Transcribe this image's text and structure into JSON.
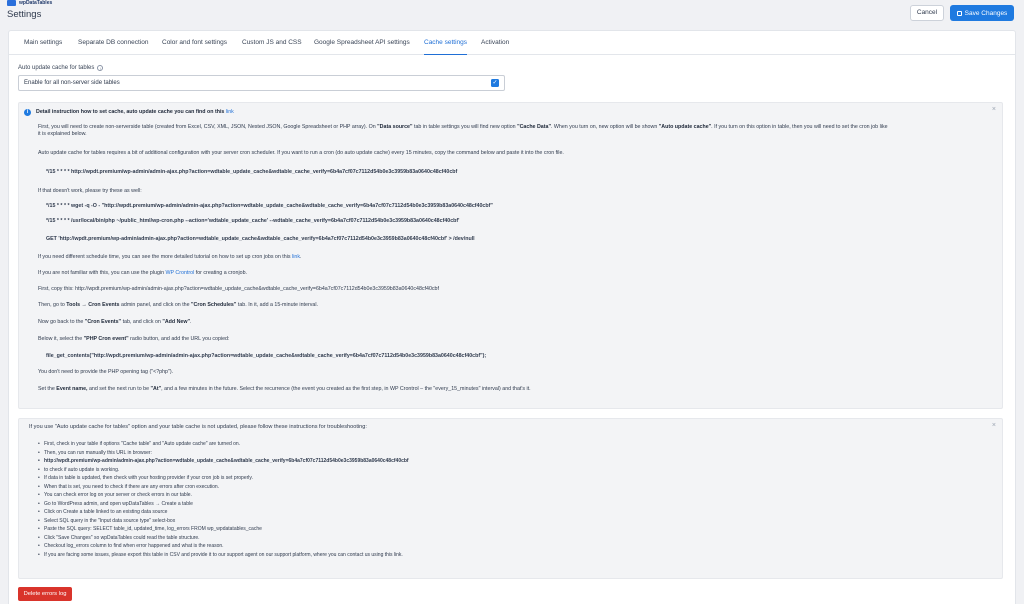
{
  "brand": {
    "logo_text": "wpDataTables"
  },
  "header": {
    "title": "Settings",
    "cancel_label": "Cancel",
    "save_label": "Save Changes"
  },
  "tabs": [
    {
      "label": "Main settings",
      "active": false
    },
    {
      "label": "Separate DB connection",
      "active": false
    },
    {
      "label": "Color and font settings",
      "active": false
    },
    {
      "label": "Custom JS and CSS",
      "active": false
    },
    {
      "label": "Google Spreadsheet API settings",
      "active": false
    },
    {
      "label": "Cache settings",
      "active": true
    },
    {
      "label": "Activation",
      "active": false
    }
  ],
  "auto_update": {
    "label": "Auto update cache for tables",
    "select_value": "Enable for all non-server side tables",
    "checked": true
  },
  "instructions": {
    "headline_pre": "Detail instruction how to set cache, auto update cache you can find on this",
    "headline_link": "link",
    "p1_a": "First, you will need to create non-serverside table (created from Excel, CSV, XML, JSON, Nested JSON, Google Spreadsheet or PHP array). On",
    "p1_b": "\"Data source\"",
    "p1_c": "tab in table settings you will find new option",
    "p1_d": "\"Cache Data\"",
    "p1_e": ". When you turn on, new option will be shown",
    "p1_f": "\"Auto update cache\"",
    "p1_g": ". If you turn on this option in table, then you will need to set the cron job like",
    "p1_line2": "it is explained below.",
    "p2": "Auto update cache for tables requires a bit of additional configuration with your server cron scheduler. If you want to run a cron (do auto update cache) every 15 minutes, copy the command below and paste it into the cron file.",
    "cmd1": "*/15 * * * * http://wpdt.premium/wp-admin/admin-ajax.php?action=wdtable_update_cache&wdtable_cache_verify=6b4a7cf07c7112d54b0e3c3959b83a0640c48cf40cbf",
    "p3": "If that doesn't work, please try these as well:",
    "cmd2": "*/15 * * * * wget -q -O - \"http://wpdt.premium/wp-admin/admin-ajax.php?action=wdtable_update_cache&wdtable_cache_verify=6b4a7cf07c7112d54b0e3c3959b83a0640c48cf40cbf\"",
    "cmd3": "*/15 * * * * /usr/local/bin/php ~/public_html/wp-cron.php --action='wdtable_update_cache' --wdtable_cache_verify=6b4a7cf07c7112d54b0e3c3959b83a0640c48cf40cbf'",
    "cmd4": "GET 'http://wpdt.premium/wp-admin/admin-ajax.php?action=wdtable_update_cache&wdtable_cache_verify=6b4a7cf07c7112d54b0e3c3959b83a0640c48cf40cbf' > /dev/null",
    "p4_pre": "If you need different schedule time, you can see the more detailed tutorial on how to set up cron jobs on this",
    "p4_link": "link",
    "p5_pre": "If you are not familiar with this, you can use the plugin",
    "p5_link": "WP Crontrol",
    "p5_post": "for creating a cronjob.",
    "p6": "First, copy this: http://wpdt.premium/wp-admin/admin-ajax.php?action=wdtable_update_cache&wdtable_cache_verify=6b4a7cf07c7112d54b0e3c3959b83a0640c48cf40cbf",
    "p7_a": "Then, go to",
    "p7_b": "Tools → Cron Events",
    "p7_c": "admin panel, and click on the",
    "p7_d": "\"Cron Schedules\"",
    "p7_e": "tab. In it, add a 15-minute interval.",
    "p8_a": "Now go back to the",
    "p8_b": "\"Cron Events\"",
    "p8_c": "tab, and click on",
    "p8_d": "\"Add New\"",
    "p9_a": "Below it, select the",
    "p9_b": "\"PHP Cron event\"",
    "p9_c": "radio button, and add the URL you copied:",
    "cmd5": "file_get_contents(\"http://wpdt.premium/wp-admin/admin-ajax.php?action=wdtable_update_cache&wdtable_cache_verify=6b4a7cf07c7112d54b0e3c3959b83a0640c48cf40cbf\");",
    "p10": "You don't need to provide the PHP opening tag (\"<?php\").",
    "p11_a": "Set the",
    "p11_b": "Event name,",
    "p11_c": "and set the next run to be",
    "p11_d": "\"At\"",
    "p11_e": ", and a few minutes in the future. Select the recurrence (the event you created as the first step, in WP Crontrol – the \"every_15_minutes\" interval) and that's it."
  },
  "troubleshoot": {
    "headline": "If you use \"Auto update cache for tables\" option and your table cache is not updated, please follow these instructions for troubleshooting:",
    "items": [
      "First, check in your table if options \"Cache table\" and \"Auto update cache\" are turned on.",
      "Then, you can run manually this URL in browser:",
      "http://wpdt.premium/wp-admin/admin-ajax.php?action=wdtable_update_cache&wdtable_cache_verify=6b4a7cf07c7112d54b0e3c3959b83a0640c48cf40cbf",
      "to check if auto update is working.",
      "If data in table is updated, then check with your hosting provider if your cron job is set properly.",
      "When that is set, you need to check if there are any errors after cron execution.",
      "You can check error log on your server or check errors in our table.",
      "Go to WordPress admin, and open wpDataTables → Create a table",
      "Click on Create a table linked to an existing data source",
      "Select SQL query in the \"Input data source type\" select-box",
      "Paste the SQL query: SELECT table_id, updated_time, log_errors FROM wp_wpdatatables_cache",
      "Click \"Save Changes\" so wpDataTables could read the table structure.",
      "Checkout log_errors column to find when error happened and what is the reason.",
      "If you are facing some issues, please export this table in CSV and provide it to our support agent on our support platform, where you can contact us using this link."
    ]
  },
  "delete_label": "Delete errors log",
  "colors": {
    "primary": "#1f7ae0",
    "danger": "#d9342b",
    "background": "#f0f1f4"
  }
}
